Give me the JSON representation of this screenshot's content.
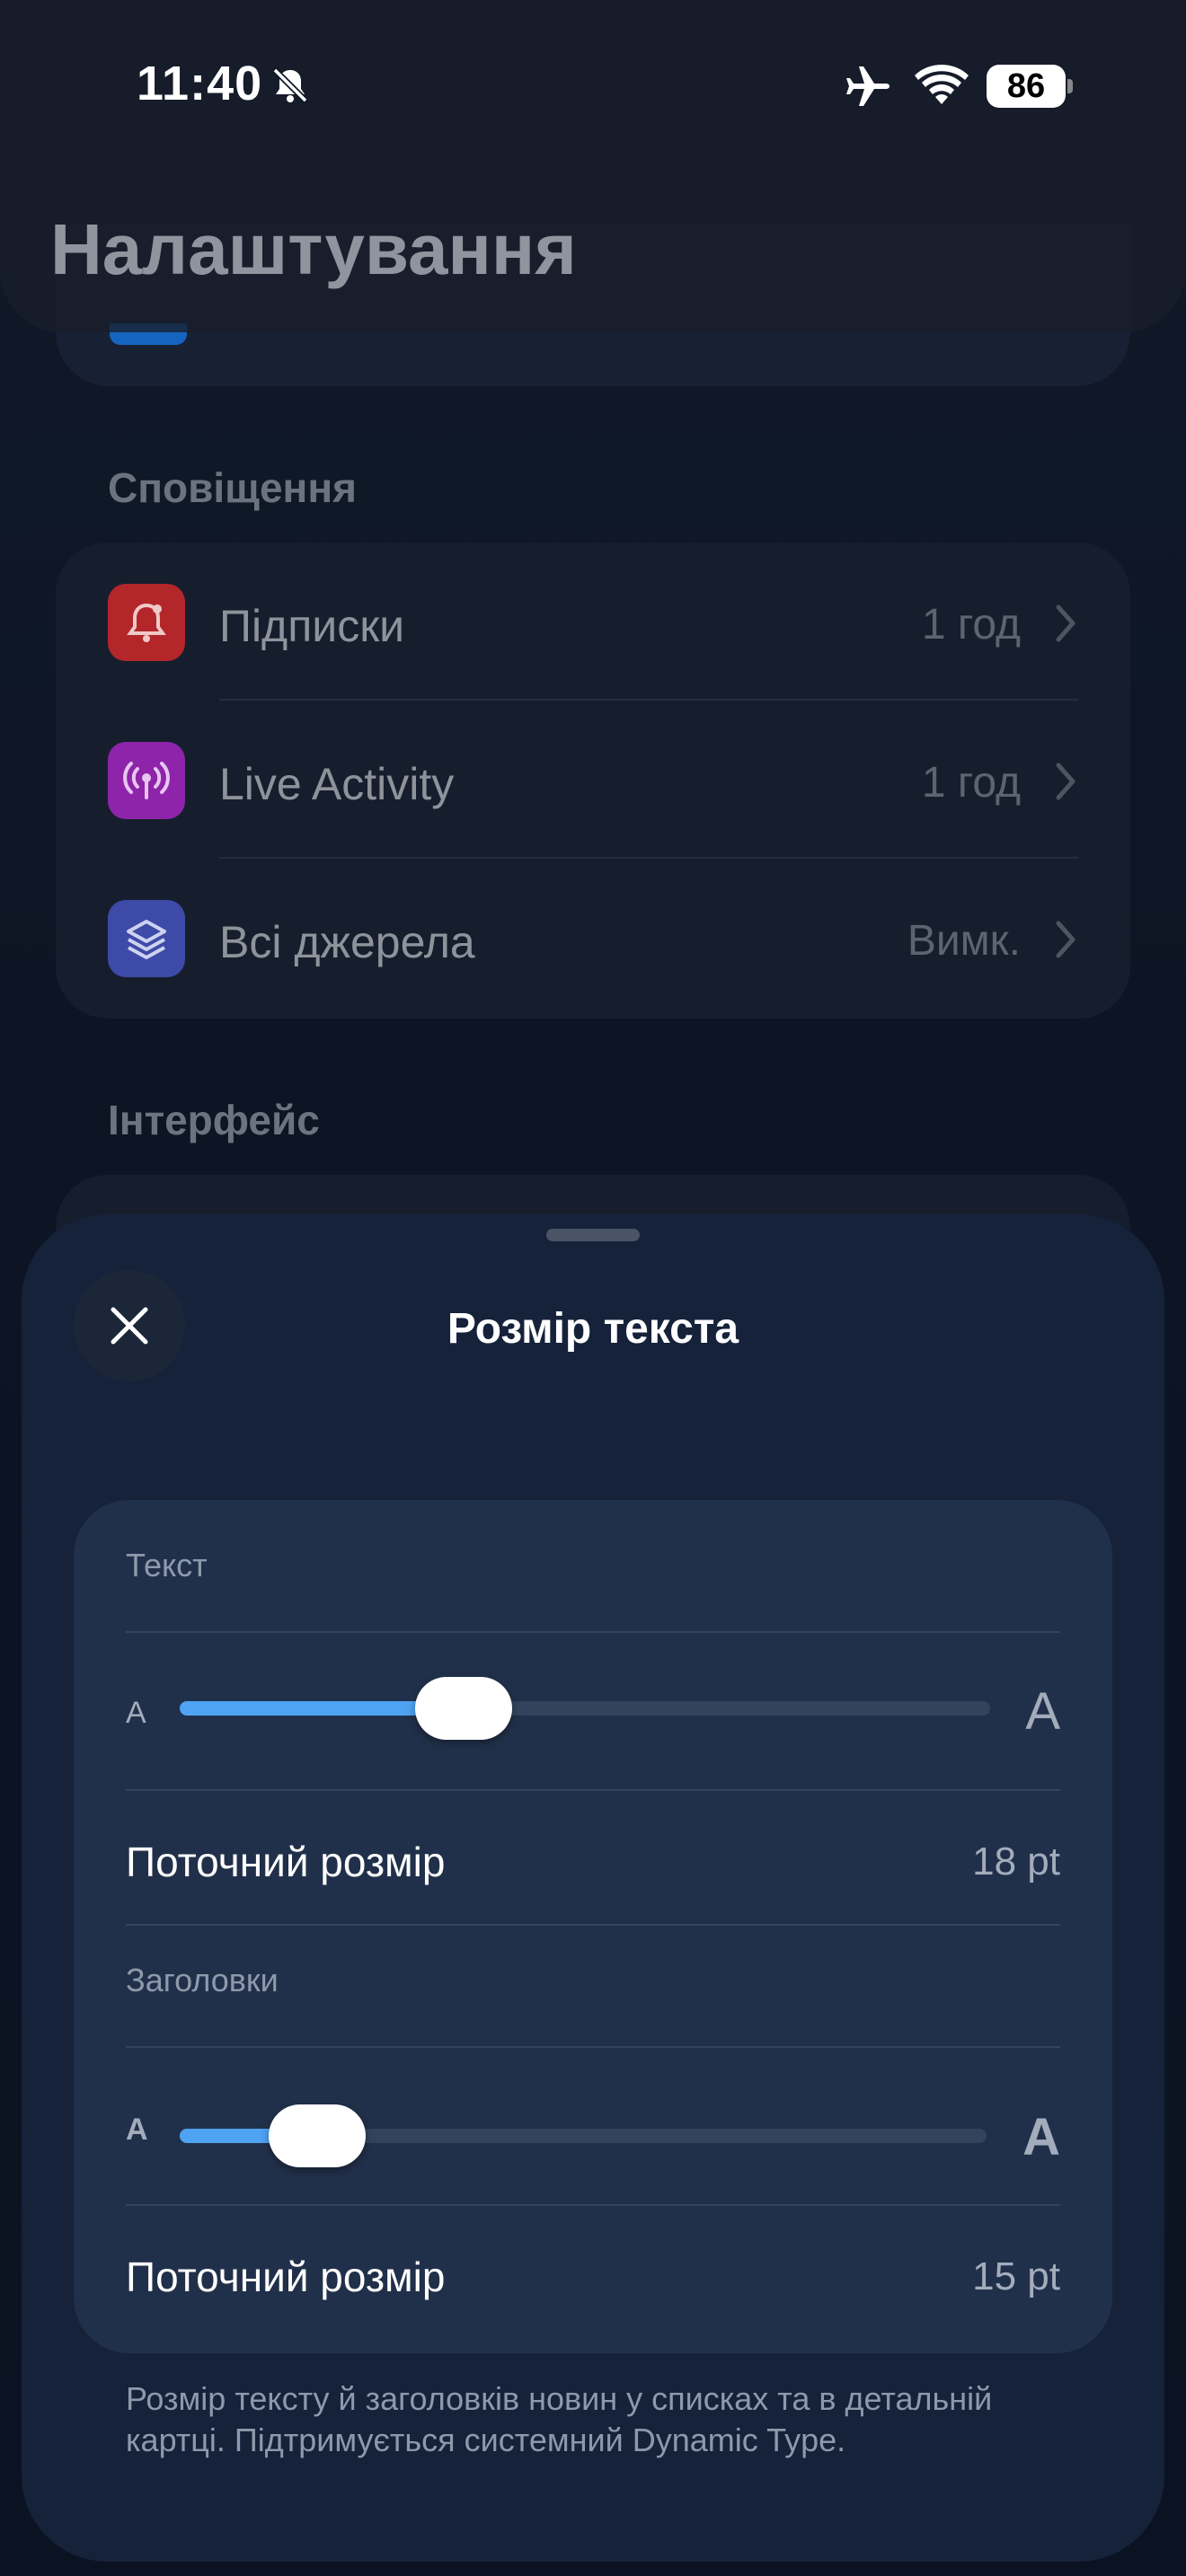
{
  "status_bar": {
    "time": "11:40",
    "battery": "86"
  },
  "page": {
    "title": "Налаштування"
  },
  "notifications": {
    "section": "Сповіщення",
    "items": [
      {
        "label": "Підписки",
        "value": "1 год",
        "icon": "bell-icon",
        "color": "#c0392b"
      },
      {
        "label": "Live Activity",
        "value": "1 год",
        "icon": "broadcast-icon",
        "color": "#8e24aa"
      },
      {
        "label": "Всі джерела",
        "value": "Вимк.",
        "icon": "layers-icon",
        "color": "#3f51b5"
      }
    ]
  },
  "interface": {
    "section": "Інтерфейс"
  },
  "sheet": {
    "title": "Розмір текста",
    "text": {
      "label": "Текст",
      "min_glyph": "A",
      "max_glyph": "A",
      "slider_fraction": 0.35,
      "current_label": "Поточний розмір",
      "current_value": "18 pt"
    },
    "headings": {
      "label": "Заголовки",
      "min_glyph": "A",
      "max_glyph": "A",
      "slider_fraction": 0.17,
      "current_label": "Поточний розмір",
      "current_value": "15 pt"
    },
    "footnote": "Розмір тексту й заголовків новин у списках та в детальній картці. Підтримується системний Dynamic Type."
  },
  "colors": {
    "accent": "#4ea3f2",
    "sheet": "#16223a",
    "card": "#21304a"
  }
}
